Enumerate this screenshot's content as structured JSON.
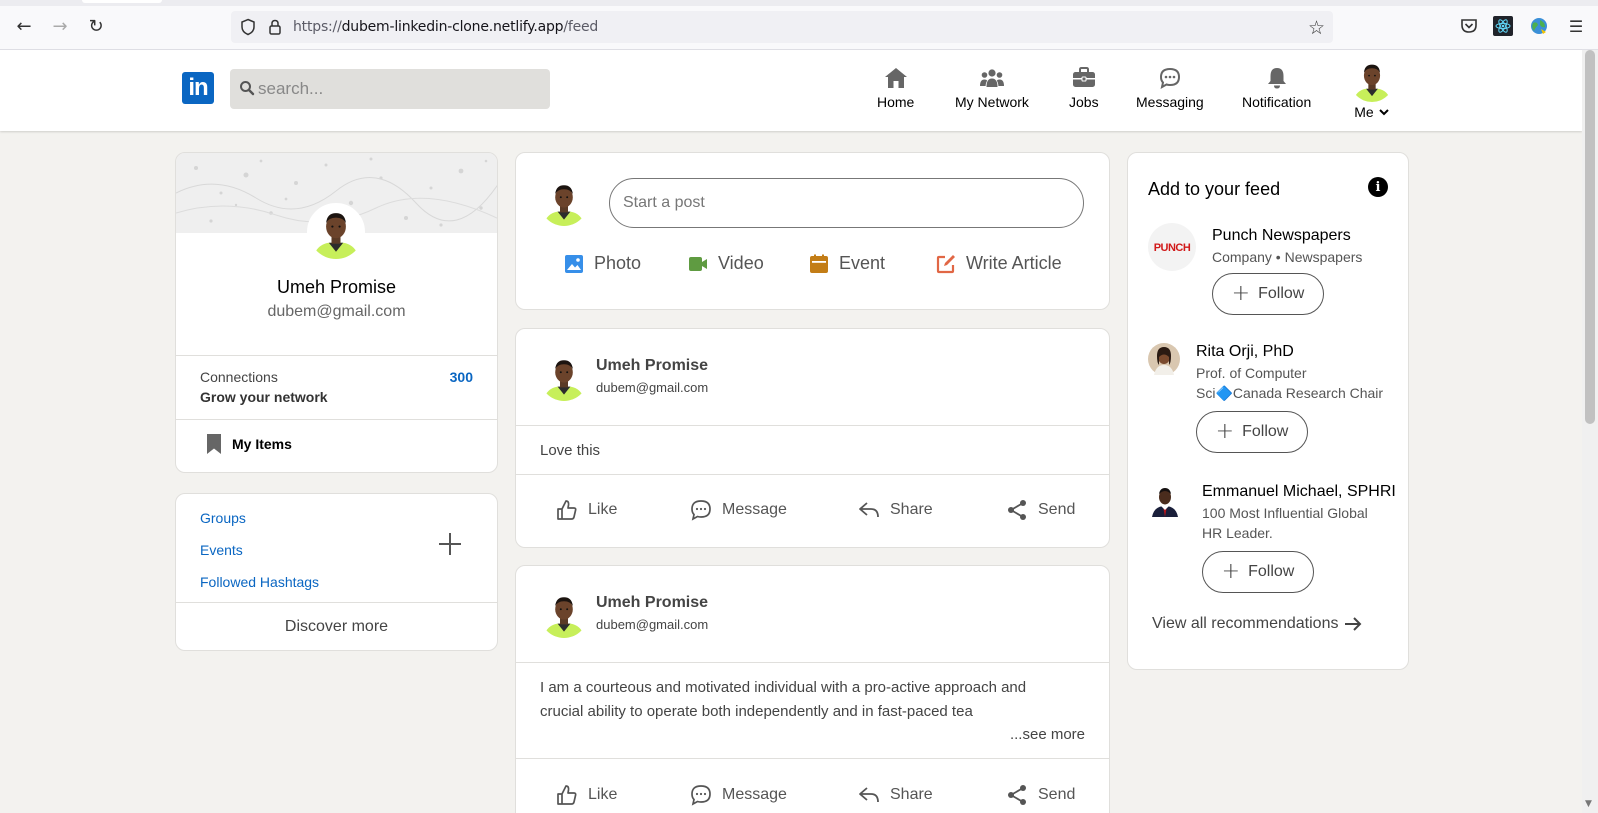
{
  "browser": {
    "url_prefix": "https://",
    "url_host": "dubem-linkedin-clone.netlify.app",
    "url_path": "/feed"
  },
  "header": {
    "logo_text": "in",
    "search_placeholder": "search...",
    "nav": [
      {
        "label": "Home",
        "icon": "home-icon"
      },
      {
        "label": "My Network",
        "icon": "people-icon"
      },
      {
        "label": "Jobs",
        "icon": "briefcase-icon"
      },
      {
        "label": "Messaging",
        "icon": "chat-icon"
      },
      {
        "label": "Notification",
        "icon": "bell-icon"
      }
    ],
    "me_label": "Me"
  },
  "profile": {
    "name": "Umeh Promise",
    "email": "dubem@gmail.com",
    "connections_label": "Connections",
    "connections_count": "300",
    "grow_label": "Grow your network",
    "my_items_label": "My Items"
  },
  "left_links": {
    "groups": "Groups",
    "events": "Events",
    "hashtags": "Followed Hashtags",
    "discover": "Discover more"
  },
  "composer": {
    "placeholder": "Start a post",
    "actions": [
      {
        "label": "Photo",
        "icon": "photo-icon",
        "color": "#378fe9"
      },
      {
        "label": "Video",
        "icon": "video-icon",
        "color": "#5f9b41"
      },
      {
        "label": "Event",
        "icon": "calendar-icon",
        "color": "#c37d16"
      },
      {
        "label": "Write Article",
        "icon": "edit-icon",
        "color": "#e16745"
      }
    ]
  },
  "posts": [
    {
      "author": "Umeh Promise",
      "email": "dubem@gmail.com",
      "text": "Love this"
    },
    {
      "author": "Umeh Promise",
      "email": "dubem@gmail.com",
      "text_line1": "I am a courteous and motivated individual with a pro-active approach and",
      "text_line2": "crucial ability to operate both independently and in fast-paced tea",
      "see_more": "...see more"
    }
  ],
  "post_actions": {
    "like": "Like",
    "message": "Message",
    "share": "Share",
    "send": "Send"
  },
  "feed_recs": {
    "title": "Add to your feed",
    "follow_label": "Follow",
    "items": [
      {
        "name": "Punch Newspapers",
        "sub1": "Company • Newspapers",
        "logo_text": "PUNCH"
      },
      {
        "name": "Rita Orji, PhD",
        "sub1": "Prof. of Computer",
        "sub2": "Sci🔷Canada Research Chair"
      },
      {
        "name": "Emmanuel Michael, SPHRI",
        "sub1": "100 Most Influential Global",
        "sub2": "HR Leader."
      }
    ],
    "view_all": "View all recommendations"
  },
  "colors": {
    "linkedin_blue": "#0a66c2",
    "page_bg": "#f3f2ef"
  }
}
